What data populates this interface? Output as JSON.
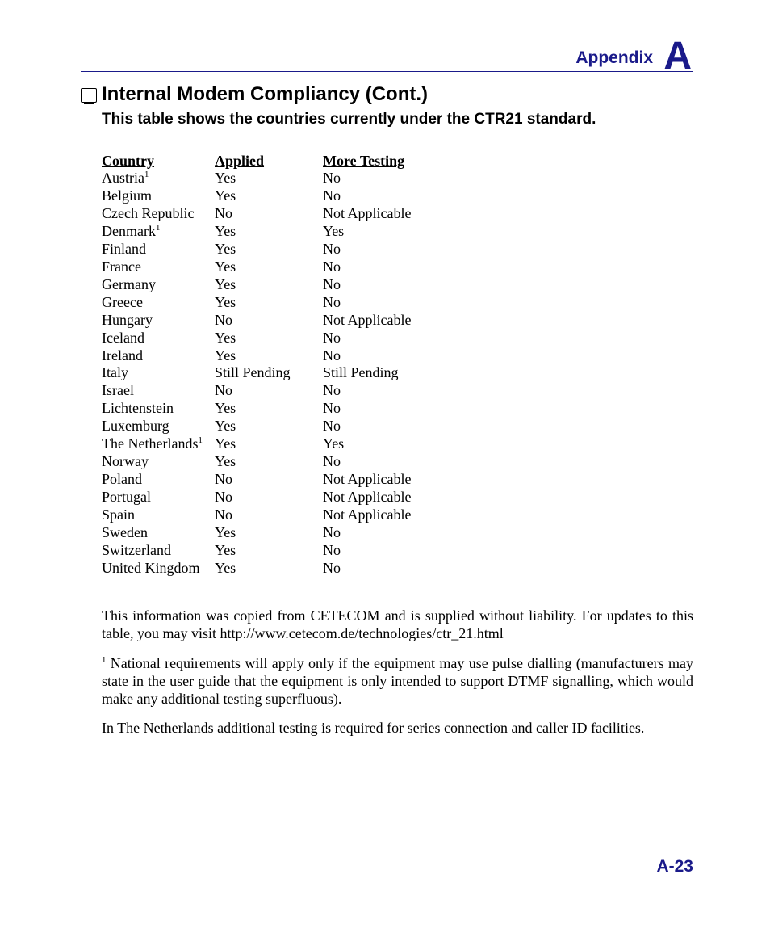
{
  "header": {
    "appendix_label": "Appendix",
    "appendix_letter": "A"
  },
  "section": {
    "title": "Internal Modem Compliancy (Cont.)",
    "subtitle": "This table shows the countries currently under the CTR21 standard."
  },
  "table": {
    "headers": {
      "country": "Country",
      "applied": "Applied",
      "more": "More Testing"
    },
    "rows": [
      {
        "country": "Austria",
        "sup": "1",
        "applied": "Yes",
        "more": "No"
      },
      {
        "country": "Belgium",
        "sup": "",
        "applied": "Yes",
        "more": "No"
      },
      {
        "country": "Czech Republic",
        "sup": "",
        "applied": "No",
        "more": "Not Applicable"
      },
      {
        "country": "Denmark",
        "sup": "1",
        "applied": "Yes",
        "more": "Yes"
      },
      {
        "country": "Finland",
        "sup": "",
        "applied": "Yes",
        "more": "No"
      },
      {
        "country": "France",
        "sup": "",
        "applied": "Yes",
        "more": "No"
      },
      {
        "country": "Germany",
        "sup": "",
        "applied": "Yes",
        "more": "No"
      },
      {
        "country": "Greece",
        "sup": "",
        "applied": "Yes",
        "more": "No"
      },
      {
        "country": "Hungary",
        "sup": "",
        "applied": "No",
        "more": "Not Applicable"
      },
      {
        "country": "Iceland",
        "sup": "",
        "applied": "Yes",
        "more": "No"
      },
      {
        "country": "Ireland",
        "sup": "",
        "applied": "Yes",
        "more": "No"
      },
      {
        "country": "Italy",
        "sup": "",
        "applied": "Still Pending",
        "more": "Still Pending"
      },
      {
        "country": "Israel",
        "sup": "",
        "applied": "No",
        "more": "No"
      },
      {
        "country": "Lichtenstein",
        "sup": "",
        "applied": "Yes",
        "more": "No"
      },
      {
        "country": "Luxemburg",
        "sup": "",
        "applied": "Yes",
        "more": "No"
      },
      {
        "country": "The Netherlands",
        "sup": "1",
        "applied": "Yes",
        "more": "Yes"
      },
      {
        "country": "Norway",
        "sup": "",
        "applied": "Yes",
        "more": "No"
      },
      {
        "country": "Poland",
        "sup": "",
        "applied": "No",
        "more": "Not Applicable"
      },
      {
        "country": "Portugal",
        "sup": "",
        "applied": "No",
        "more": "Not Applicable"
      },
      {
        "country": "Spain",
        "sup": "",
        "applied": "No",
        "more": "Not Applicable"
      },
      {
        "country": "Sweden",
        "sup": "",
        "applied": "Yes",
        "more": "No"
      },
      {
        "country": "Switzerland",
        "sup": "",
        "applied": "Yes",
        "more": "No"
      },
      {
        "country": "United Kingdom",
        "sup": "",
        "applied": "Yes",
        "more": "No"
      }
    ]
  },
  "paragraphs": {
    "p1": "This information was copied from CETECOM and is supplied without liability. For updates to this table, you may visit http://www.cetecom.de/technologies/ctr_21.html",
    "p2_sup": "1",
    "p2": " National requirements will apply only if the equipment may use pulse dialling (manufacturers may state in the user guide that the equipment is only intended to support DTMF signalling, which would make any additional testing superfluous).",
    "p3": "In The Netherlands additional testing is required for series connection and caller ID facilities."
  },
  "footer": {
    "page": "A-23"
  }
}
